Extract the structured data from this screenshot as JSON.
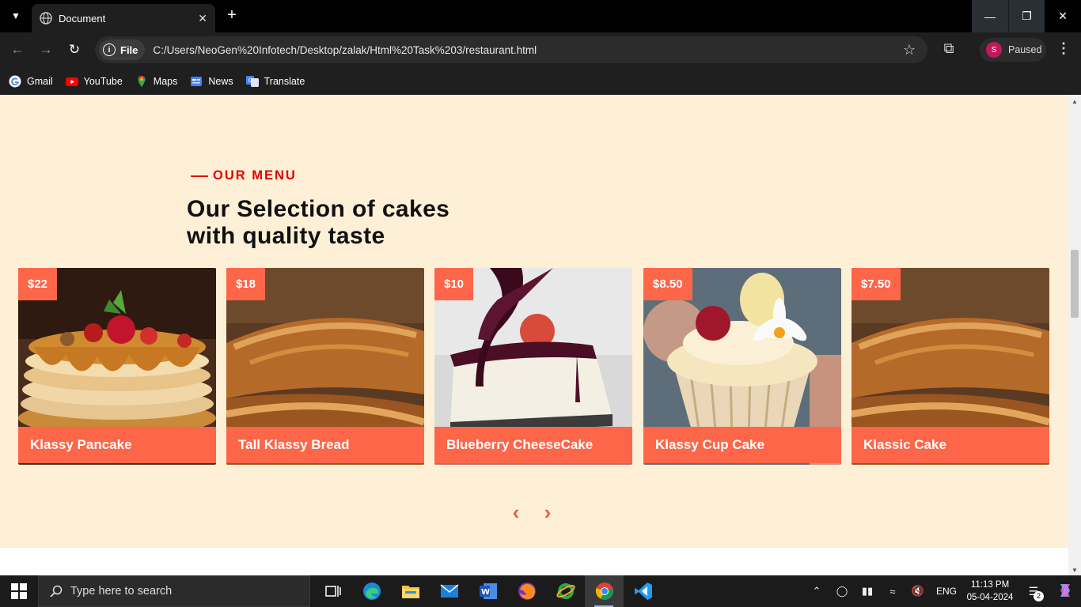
{
  "browser": {
    "tab_title": "Document",
    "site_chip": "File",
    "url": "C:/Users/NeoGen%20Infotech/Desktop/zalak/Html%20Task%203/restaurant.html",
    "profile_initial": "S",
    "profile_status": "Paused",
    "bookmarks": [
      {
        "label": "Gmail",
        "icon": "gmail-icon"
      },
      {
        "label": "YouTube",
        "icon": "youtube-icon"
      },
      {
        "label": "Maps",
        "icon": "maps-icon"
      },
      {
        "label": "News",
        "icon": "news-icon"
      },
      {
        "label": "Translate",
        "icon": "translate-icon"
      }
    ]
  },
  "menu": {
    "eyebrow": "OUR MENU",
    "headline_line1": "Our Selection of cakes",
    "headline_line2": "with quality taste",
    "items": [
      {
        "price": "$22",
        "name": "Klassy Pancake"
      },
      {
        "price": "$18",
        "name": "Tall Klassy Bread"
      },
      {
        "price": "$10",
        "name": "Blueberry CheeseCake"
      },
      {
        "price": "$8.50",
        "name": "Klassy Cup Cake"
      },
      {
        "price": "$7.50",
        "name": "Klassic Cake"
      }
    ],
    "prev_arrow": "‹",
    "next_arrow": "›"
  },
  "taskbar": {
    "search_placeholder": "Type here to search",
    "language": "ENG",
    "time": "11:13 PM",
    "date": "05-04-2024",
    "notification_count": "2"
  },
  "colors": {
    "accent": "#fd6649",
    "eyebrow": "#e10000",
    "section_bg": "#fdf0d6"
  }
}
